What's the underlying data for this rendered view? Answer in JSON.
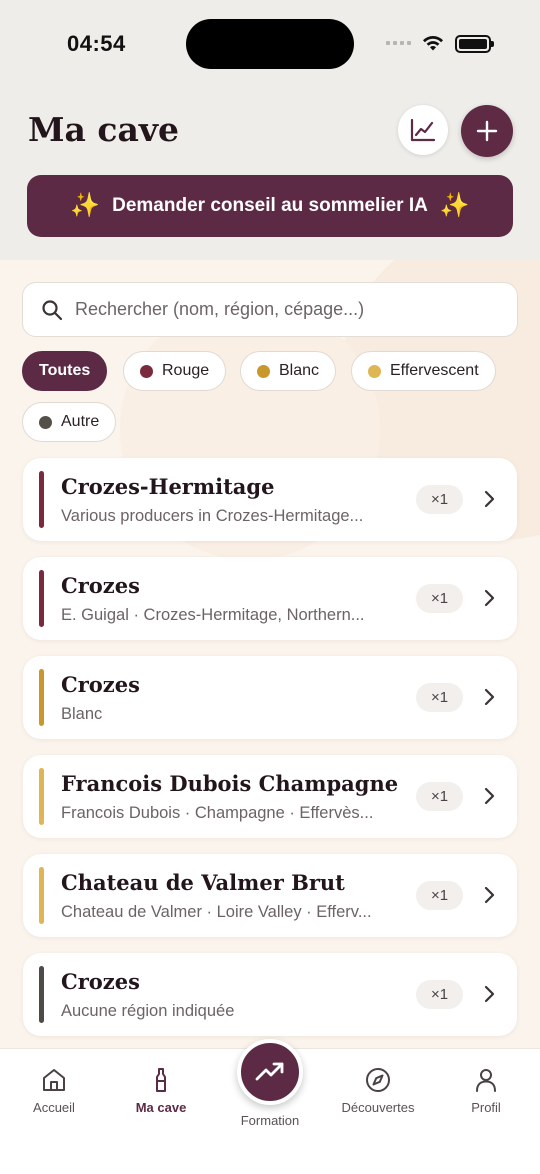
{
  "status": {
    "time": "04:54"
  },
  "header": {
    "title": "Ma cave",
    "ai_button_label": "Demander conseil au sommelier IA"
  },
  "icons": {
    "stats": "chart-icon",
    "add": "plus-icon",
    "search": "search-icon",
    "chevron": "chevron-right-icon",
    "sparkle": "sparkle-icon"
  },
  "search": {
    "placeholder": "Rechercher (nom, région, cépage...)",
    "value": ""
  },
  "filters": [
    {
      "label": "Toutes",
      "color": "",
      "active": true
    },
    {
      "label": "Rouge",
      "color": "#7a2a3e",
      "active": false
    },
    {
      "label": "Blanc",
      "color": "#c9982c",
      "active": false
    },
    {
      "label": "Effervescent",
      "color": "#dfb654",
      "active": false
    },
    {
      "label": "Autre",
      "color": "#555049",
      "active": false
    }
  ],
  "wines": [
    {
      "name": "Crozes-Hermitage",
      "subtitle": "Various producers in Crozes-Hermitage...",
      "qty": "×1",
      "color": "#7a2a3e"
    },
    {
      "name": "Crozes",
      "subtitle": "E. Guigal · Crozes-Hermitage, Northern...",
      "qty": "×1",
      "color": "#7a2a3e"
    },
    {
      "name": "Crozes",
      "subtitle": "Blanc",
      "qty": "×1",
      "color": "#c9982c"
    },
    {
      "name": "Francois Dubois Champagne",
      "subtitle": "Francois Dubois · Champagne · Effervès...",
      "qty": "×1",
      "color": "#dfb654"
    },
    {
      "name": "Chateau de Valmer Brut",
      "subtitle": "Chateau de Valmer · Loire Valley · Efferv...",
      "qty": "×1",
      "color": "#dfb654"
    },
    {
      "name": "Crozes",
      "subtitle": "Aucune région indiquée",
      "qty": "×1",
      "color": "#4e4a47"
    }
  ],
  "tabs": [
    {
      "label": "Accueil",
      "icon": "home-icon"
    },
    {
      "label": "Ma cave",
      "icon": "bottle-icon",
      "active": true
    },
    {
      "label": "Formation",
      "icon": "trending-up-icon"
    },
    {
      "label": "Découvertes",
      "icon": "compass-icon"
    },
    {
      "label": "Profil",
      "icon": "user-icon"
    }
  ],
  "colors": {
    "accent": "#5d2a45",
    "background": "#fbf4ec"
  }
}
